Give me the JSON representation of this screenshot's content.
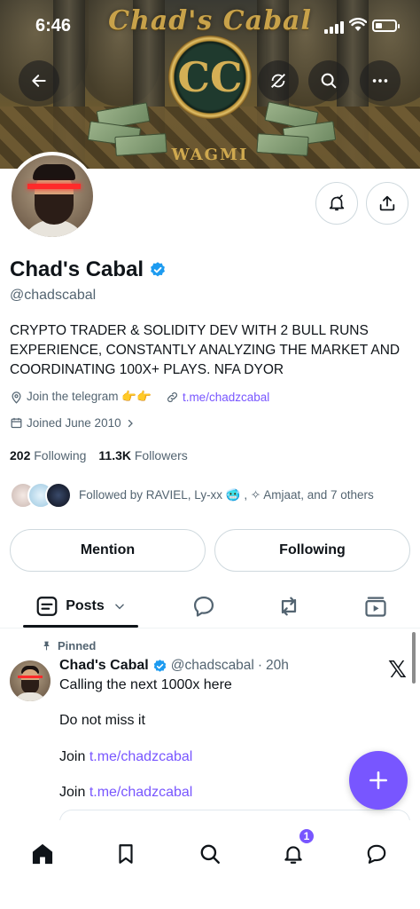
{
  "status_bar": {
    "time": "6:46"
  },
  "banner": {
    "title": "Chad's Cabal",
    "emblem_text": "CC",
    "footer_text": "WAGMI"
  },
  "profile": {
    "name": "Chad's Cabal",
    "handle": "@chadscabal",
    "bio": "CRYPTO TRADER & SOLIDITY DEV WITH 2 BULL RUNS EXPERIENCE, CONSTANTLY ANALYZING THE MARKET AND COORDINATING 100X+ PLAYS. NFA DYOR",
    "location": "Join the telegram 👉👉",
    "website": "t.me/chadzcabal",
    "joined": "Joined June 2010",
    "following_count": "202",
    "following_label": "Following",
    "followers_count": "11.3K",
    "followers_label": "Followers",
    "followed_by": "Followed by RAVIEL, Ly-xx 🥶 , ✧ Amjaat, and 7 others"
  },
  "actions": {
    "mention_label": "Mention",
    "following_label": "Following"
  },
  "tabs": {
    "posts_label": "Posts"
  },
  "post": {
    "pinned_label": "Pinned",
    "author_name": "Chad's Cabal",
    "author_handle": "@chadscabal",
    "separator": "·",
    "time": "20h",
    "line1": "Calling the next 1000x here",
    "line2": "Do not miss it",
    "join_prefix": "Join",
    "join_link_1": "t.me/chadzcabal",
    "join_link_2": "t.me/chadzcabal"
  },
  "bottom_nav": {
    "notifications_badge": "1"
  },
  "colors": {
    "accent": "#7856ff",
    "verified": "#1d9bf0",
    "text_primary": "#0f1419",
    "text_secondary": "#536471"
  },
  "icons": [
    "back-arrow-icon",
    "refresh-off-icon",
    "search-icon",
    "more-icon",
    "bell-check-icon",
    "share-icon",
    "verified-icon",
    "location-icon",
    "link-icon",
    "calendar-icon",
    "chevron-right-icon",
    "posts-icon",
    "chevron-down-icon",
    "reply-icon",
    "repost-icon",
    "media-icon",
    "pin-icon",
    "x-logo-icon",
    "plus-icon",
    "home-icon",
    "bookmark-icon",
    "notifications-icon",
    "messages-icon"
  ]
}
